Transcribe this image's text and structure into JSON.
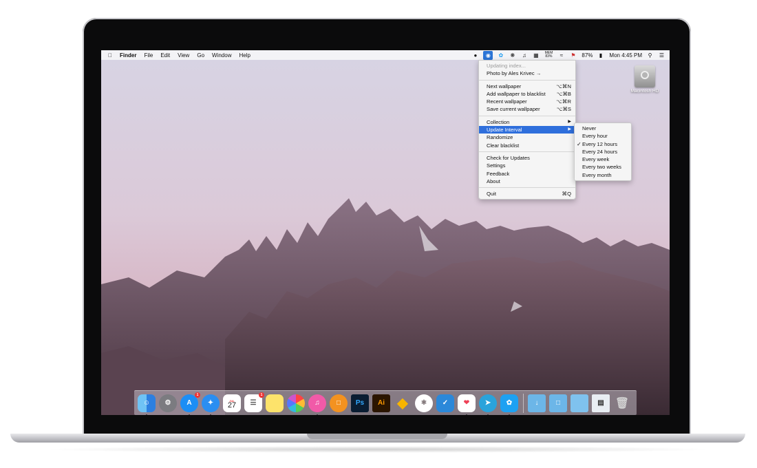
{
  "menubar": {
    "apple_icon": "apple-icon",
    "app_name": "Finder",
    "items": [
      "File",
      "Edit",
      "View",
      "Go",
      "Window",
      "Help"
    ],
    "status": {
      "battery_percent": "87%",
      "clock": "Mon 4:45 PM",
      "mem_label": "MEM",
      "mem_value": "83%"
    }
  },
  "menu": {
    "header_items": [
      {
        "label": "Updating index...",
        "disabled": true
      },
      {
        "label": "Photo by Ales Krivec →",
        "disabled": false
      }
    ],
    "group1": [
      {
        "label": "Next wallpaper",
        "shortcut": "⌥⌘N"
      },
      {
        "label": "Add wallpaper to blacklist",
        "shortcut": "⌥⌘B"
      },
      {
        "label": "Recent wallpaper",
        "shortcut": "⌥⌘R"
      },
      {
        "label": "Save current wallpaper",
        "shortcut": "⌥⌘S"
      }
    ],
    "group2": [
      {
        "label": "Collection",
        "shortcut": "▶"
      },
      {
        "label": "Update Interval",
        "shortcut": "▶"
      },
      {
        "label": "Randomize",
        "shortcut": ""
      },
      {
        "label": "Clear blacklist",
        "shortcut": ""
      }
    ],
    "group3": [
      {
        "label": "Check for Updates"
      },
      {
        "label": "Settings"
      },
      {
        "label": "Feedback"
      },
      {
        "label": "About"
      }
    ],
    "quit": {
      "label": "Quit",
      "shortcut": "⌘Q"
    }
  },
  "submenu": {
    "items": [
      "Never",
      "Every hour",
      "Every 12 hours",
      "Every 24 hours",
      "Every week",
      "Every two weeks",
      "Every month"
    ],
    "checked": "Every 12 hours"
  },
  "desktop": {
    "hd_label": "Macintosh HD"
  },
  "dock": {
    "calendar_month": "JUL",
    "calendar_day": "27",
    "appstore_badge": "1",
    "reminders_badge": "1",
    "photoshop_label": "Ps",
    "illustrator_label": "Ai"
  },
  "colors": {
    "selection": "#2f6fdc",
    "menu_bg": "#f6f6f6"
  }
}
